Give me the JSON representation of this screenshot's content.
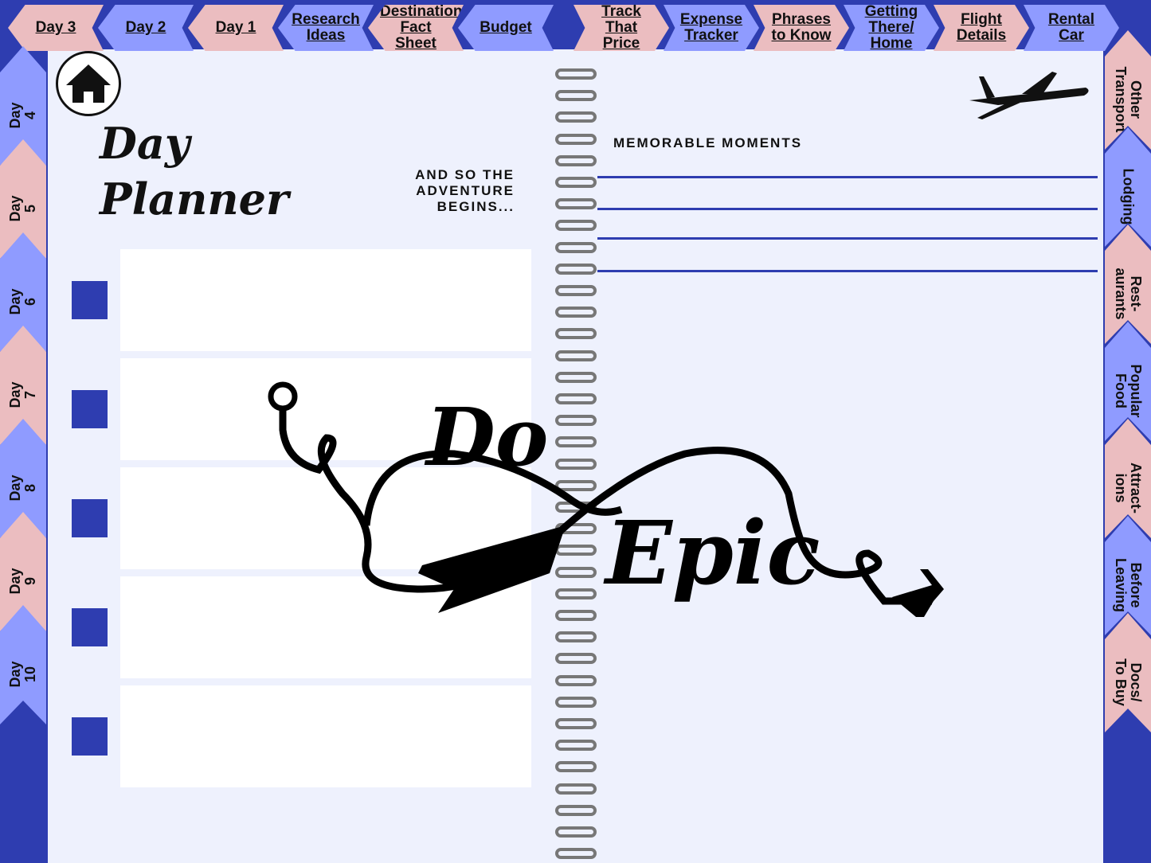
{
  "top_tabs": [
    {
      "label": "Day 3",
      "color": "pink"
    },
    {
      "label": "Day 2",
      "color": "blue"
    },
    {
      "label": "Day 1",
      "color": "pink"
    },
    {
      "label": "Research Ideas",
      "color": "blue"
    },
    {
      "label": "Destination Fact Sheet",
      "color": "pink"
    },
    {
      "label": "Budget",
      "color": "blue"
    },
    {
      "label": "Track That Price",
      "color": "pink"
    },
    {
      "label": "Expense Tracker",
      "color": "blue"
    },
    {
      "label": "Phrases to Know",
      "color": "pink"
    },
    {
      "label": "Getting There/ Home",
      "color": "blue"
    },
    {
      "label": "Flight Details",
      "color": "pink"
    },
    {
      "label": "Rental Car",
      "color": "blue"
    }
  ],
  "left_tabs": [
    "Day\n4",
    "Day\n5",
    "Day\n6",
    "Day\n7",
    "Day\n8",
    "Day\n9",
    "Day\n10"
  ],
  "right_tabs": [
    "Other\nTransport",
    "Lodging",
    "Rest-\naurants",
    "Popular\nFood",
    "Attract-\nions",
    "Before\nLeaving",
    "Docs/\nTo Buy"
  ],
  "page": {
    "title": "Day\nPlanner",
    "tagline": "AND SO THE ADVENTURE BEGINS...",
    "memorable_heading": "MEMORABLE MOMENTS",
    "graphic_text_1": "Do",
    "graphic_text_2": "Epic"
  },
  "colors": {
    "pink": "#EBBDC0",
    "blue": "#8F9BFF",
    "dark": "#2E3DB0",
    "page": "#EEF1FD"
  }
}
